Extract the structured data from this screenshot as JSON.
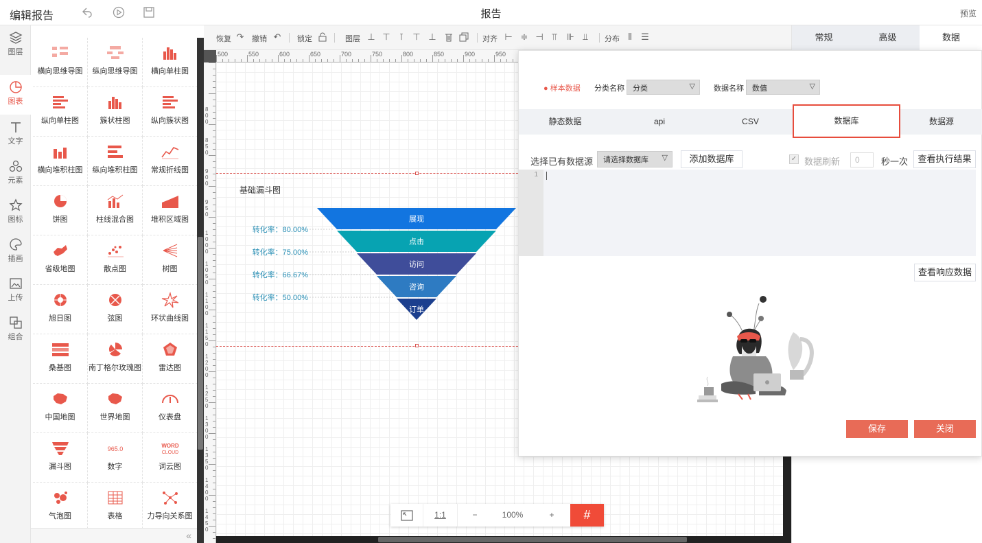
{
  "header": {
    "title": "编辑报告",
    "center_title": "报告",
    "preview": "预览"
  },
  "sidebar": {
    "items": [
      {
        "label": "图层"
      },
      {
        "label": "图表",
        "active": true
      },
      {
        "label": "文字"
      },
      {
        "label": "元素"
      },
      {
        "label": "图标"
      },
      {
        "label": "插画"
      },
      {
        "label": "上传"
      },
      {
        "label": "组合"
      }
    ]
  },
  "palette": {
    "items": [
      "横向思维导图",
      "纵向思维导图",
      "横向单柱图",
      "纵向单柱图",
      "簇状柱图",
      "纵向簇状图",
      "横向堆积柱图",
      "纵向堆积柱图",
      "常规折线图",
      "饼图",
      "柱线混合图",
      "堆积区域图",
      "省级地图",
      "散点图",
      "树图",
      "旭日图",
      "弦图",
      "环状曲线图",
      "桑基图",
      "南丁格尔玫瑰图",
      "雷达图",
      "中国地图",
      "世界地图",
      "仪表盘",
      "漏斗图",
      "数字",
      "词云图",
      "气泡图",
      "表格",
      "力导向关系图"
    ],
    "number_icon_text": "965.0",
    "wordcloud_icon_text": [
      "WORD",
      "CLOUD"
    ],
    "collapse": "«"
  },
  "toolbar": {
    "restore": "恢复",
    "undo": "撤销",
    "lock": "锁定",
    "layer": "图层",
    "align": "对齐",
    "distribute": "分布"
  },
  "rulers": {
    "h": [
      "500",
      "550",
      "600",
      "650",
      "700",
      "750",
      "800",
      "850",
      "900",
      "950"
    ],
    "v": [
      "800",
      "850",
      "900",
      "950",
      "1000",
      "1050",
      "1100",
      "1150",
      "1200",
      "1250",
      "1300",
      "1350",
      "1400",
      "1450"
    ]
  },
  "funnel": {
    "title": "基础漏斗图",
    "stages": [
      {
        "label": "展现",
        "color": "#1275e0"
      },
      {
        "label": "点击",
        "color": "#07a3b2"
      },
      {
        "label": "访问",
        "color": "#3f4d9a"
      },
      {
        "label": "咨询",
        "color": "#2e7bc2"
      },
      {
        "label": "订单",
        "color": "#1c3f8e"
      }
    ],
    "rates": [
      "转化率：80.00%",
      "转化率：75.00%",
      "转化率：66.67%",
      "转化率：50.00%"
    ]
  },
  "zoom": {
    "ratio_label": "1:1",
    "minus": "−",
    "value": "100%",
    "plus": "+",
    "grid_icon": "#"
  },
  "right_panel": {
    "tabs": [
      "常规",
      "高级",
      "数据"
    ],
    "active_tab": "数据"
  },
  "dialog": {
    "sample_data": "● 样本数据",
    "category_label": "分类名称",
    "category_value": "分类",
    "value_label": "数据名称",
    "value_value": "数值",
    "tabs": [
      "静态数据",
      "api",
      "CSV",
      "数据库",
      "数据源"
    ],
    "active_tab": "数据库",
    "select_source_label": "选择已有数据源",
    "select_source_placeholder": "请选择数据库",
    "add_db_button": "添加数据库",
    "refresh_label": "数据刷新",
    "refresh_value": "0",
    "refresh_unit": "秒一次",
    "exec_result_button": "查看执行结果",
    "line_number": "1",
    "response_button": "查看响应数据",
    "save_button": "保存",
    "close_button": "关闭",
    "accent": "#e86b57"
  }
}
